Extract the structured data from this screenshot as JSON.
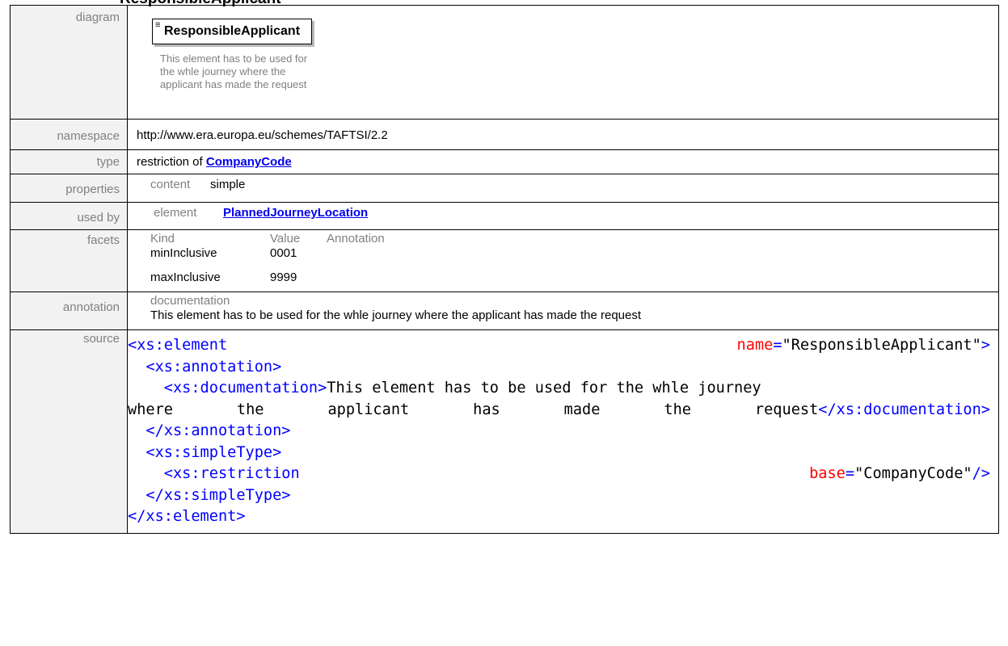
{
  "heading": "ResponsibleApplicant",
  "rows": {
    "diagram_label": "diagram",
    "namespace_label": "namespace",
    "type_label": "type",
    "properties_label": "properties",
    "usedby_label": "used by",
    "facets_label": "facets",
    "annotation_label": "annotation",
    "source_label": "source"
  },
  "diagram": {
    "element_name": "ResponsibleApplicant",
    "doc_lines": [
      "This element has to be used for",
      "the whle journey where the",
      "applicant has made the request"
    ]
  },
  "namespace": "http://www.era.europa.eu/schemes/TAFTSI/2.2",
  "type": {
    "prefix": "restriction of ",
    "link": "CompanyCode"
  },
  "properties": {
    "key": "content",
    "value": "simple"
  },
  "used_by": {
    "key": "element",
    "link": "PlannedJourneyLocation"
  },
  "facets": {
    "headers": [
      "Kind",
      "Value",
      "Annotation"
    ],
    "rows": [
      {
        "kind": "minInclusive",
        "value": "0001"
      },
      {
        "kind": "maxInclusive",
        "value": "9999"
      }
    ]
  },
  "annotation": {
    "header": "documentation",
    "text": "This element has to be used for the whle journey where the applicant has made the request"
  },
  "source": {
    "open": "<xs:element",
    "name_attr": "name",
    "name_val": "\"ResponsibleApplicant\"",
    "close_gt": ">",
    "ann_open": "<xs:annotation>",
    "doc_open": "<xs:documentation>",
    "doc_text_1": "This element has to be used for the whle journey",
    "doc_text_2_words": [
      "where",
      "the",
      "applicant",
      "has",
      "made",
      "the",
      "request"
    ],
    "doc_close": "</xs:documentation>",
    "ann_close": "</xs:annotation>",
    "st_open": "<xs:simpleType>",
    "restr_open": "<xs:restriction",
    "base_attr": "base",
    "base_val": "\"CompanyCode\"",
    "self_close": "/>",
    "st_close": "</xs:simpleType>",
    "el_close": "</xs:element>",
    "eq": "="
  },
  "colors": {
    "tag": "#0000ff",
    "attr": "#ff0000",
    "name": "#a31515",
    "link": "#0000ee",
    "label_bg": "#f2f2f2"
  }
}
